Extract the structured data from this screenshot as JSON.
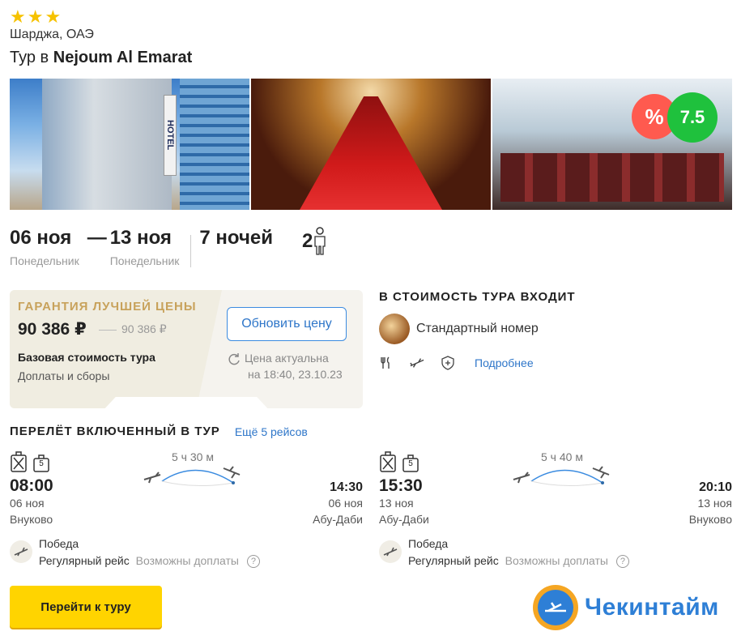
{
  "hotel": {
    "stars": [
      "★",
      "★",
      "★"
    ],
    "location": "Шарджа, ОАЭ",
    "title_prefix": "Тур в",
    "name": "Nejoum Al Emarat",
    "discount_badge": "%",
    "rating": "7.5",
    "sign_text": "HOTEL"
  },
  "dates": {
    "from": "06 ноя",
    "from_weekday": "Понедельник",
    "dash": "—",
    "to": "13 ноя",
    "to_weekday": "Понедельник",
    "nights": "7 ночей",
    "people": "2"
  },
  "price": {
    "guarantee": "ГАРАНТИЯ ЛУЧШЕЙ ЦЕНЫ",
    "current": "90 386 ₽",
    "old": "90 386 ₽",
    "base_label": "Базовая стоимость тура",
    "fees_label": "Доплаты и сборы",
    "refresh_button": "Обновить цену",
    "actual_line1": "Цена актуальна",
    "actual_line2": "на 18:40, 23.10.23"
  },
  "included": {
    "title": "В СТОИМОСТЬ ТУРА ВХОДИТ",
    "room": "Стандартный номер",
    "more_link": "Подробнее",
    "icons": [
      "fork-knife-icon",
      "plane-icon",
      "shield-plus-icon"
    ]
  },
  "flights": {
    "title": "ПЕРЕЛЁТ ВКЛЮЧЕННЫЙ В ТУР",
    "more": "Ещё 5 рейсов",
    "outbound": {
      "hand_luggage": "5",
      "duration": "5 ч 30 м",
      "dep_time": "08:00",
      "dep_date": "06 ноя",
      "dep_city": "Внуково",
      "arr_time": "14:30",
      "arr_date": "06 ноя",
      "arr_city": "Абу-Даби",
      "airline": "Победа",
      "type": "Регулярный рейс",
      "extras": "Возможны доплаты",
      "help": "?"
    },
    "return": {
      "hand_luggage": "5",
      "duration": "5 ч 40 м",
      "dep_time": "15:30",
      "dep_date": "13 ноя",
      "dep_city": "Абу-Даби",
      "arr_time": "20:10",
      "arr_date": "13 ноя",
      "arr_city": "Внуково",
      "airline": "Победа",
      "type": "Регулярный рейс",
      "extras": "Возможны доплаты",
      "help": "?"
    }
  },
  "cta": {
    "go_button": "Перейти к туру"
  },
  "brand": {
    "name": "Чекинтайм"
  },
  "colors": {
    "accent_blue": "#2e76c9",
    "star": "#f6c200",
    "rating_green": "#1fc13d",
    "discount_red": "#ff5a4f",
    "guarantee_gold": "#c8a25b",
    "cta_yellow": "#ffd400"
  }
}
